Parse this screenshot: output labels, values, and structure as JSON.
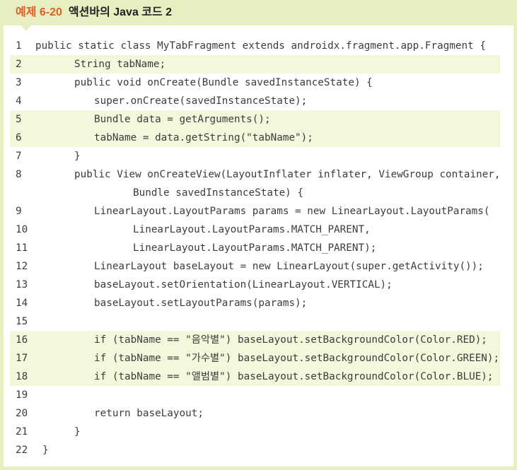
{
  "header": {
    "example_label": "예제 6-20",
    "title": "액션바의 Java 코드 2"
  },
  "colors": {
    "frame": "#e8eec0",
    "accent": "#e35d27",
    "highlight": "#f5f7dc",
    "text": "#3c3c3c"
  },
  "code": {
    "lines": [
      {
        "number": "1",
        "text": "public static class MyTabFragment extends androidx.fragment.app.Fragment {",
        "highlighted": false
      },
      {
        "number": "2",
        "text": "String tabName;",
        "highlighted": true
      },
      {
        "number": "3",
        "text": "public void onCreate(Bundle savedInstanceState) {",
        "highlighted": false
      },
      {
        "number": "4",
        "text": "super.onCreate(savedInstanceState);",
        "highlighted": false
      },
      {
        "number": "5",
        "text": "Bundle data = getArguments();",
        "highlighted": true
      },
      {
        "number": "6",
        "text": "tabName = data.getString(\"tabName\");",
        "highlighted": true
      },
      {
        "number": "7",
        "text": "}",
        "highlighted": false
      },
      {
        "number": "8",
        "text": "public View onCreateView(LayoutInflater inflater, ViewGroup container,",
        "highlighted": false
      },
      {
        "number": "",
        "text": "Bundle savedInstanceState) {",
        "highlighted": false
      },
      {
        "number": "9",
        "text": "LinearLayout.LayoutParams params = new LinearLayout.LayoutParams(",
        "highlighted": false
      },
      {
        "number": "10",
        "text": "LinearLayout.LayoutParams.MATCH_PARENT,",
        "highlighted": false
      },
      {
        "number": "11",
        "text": "LinearLayout.LayoutParams.MATCH_PARENT);",
        "highlighted": false
      },
      {
        "number": "12",
        "text": "LinearLayout baseLayout = new LinearLayout(super.getActivity());",
        "highlighted": false
      },
      {
        "number": "13",
        "text": "baseLayout.setOrientation(LinearLayout.VERTICAL);",
        "highlighted": false
      },
      {
        "number": "14",
        "text": "baseLayout.setLayoutParams(params);",
        "highlighted": false
      },
      {
        "number": "15",
        "text": "",
        "highlighted": false
      },
      {
        "number": "16",
        "text": "if (tabName == \"음악별\") baseLayout.setBackgroundColor(Color.RED);",
        "highlighted": true
      },
      {
        "number": "17",
        "text": "if (tabName == \"가수별\") baseLayout.setBackgroundColor(Color.GREEN);",
        "highlighted": true
      },
      {
        "number": "18",
        "text": "if (tabName == \"앨범별\") baseLayout.setBackgroundColor(Color.BLUE);",
        "highlighted": true
      },
      {
        "number": "19",
        "text": "",
        "highlighted": false
      },
      {
        "number": "20",
        "text": "return baseLayout;",
        "highlighted": false
      },
      {
        "number": "21",
        "text": "}",
        "highlighted": false
      },
      {
        "number": "22",
        "text": "}",
        "highlighted": false
      }
    ]
  }
}
